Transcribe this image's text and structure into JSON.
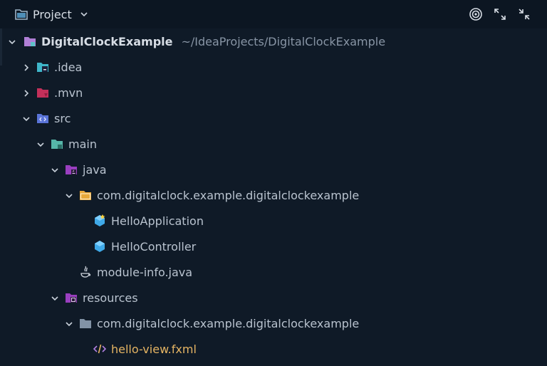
{
  "header": {
    "title": "Project",
    "icons": [
      "folder-icon",
      "chevron-down-icon",
      "target-icon",
      "expand-icon",
      "collapse-icon"
    ]
  },
  "tree": {
    "root": {
      "label": "DigitalClockExample",
      "path": "~/IdeaProjects/DigitalClockExample"
    },
    "items": [
      {
        "label": ".idea",
        "icon": "idea-folder-icon"
      },
      {
        "label": ".mvn",
        "icon": "mvn-folder-icon"
      },
      {
        "label": "src",
        "icon": "src-folder-icon"
      },
      {
        "label": "main",
        "icon": "main-folder-icon"
      },
      {
        "label": "java",
        "icon": "java-folder-icon"
      },
      {
        "label": "com.digitalclock.example.digitalclockexample",
        "icon": "package-icon"
      },
      {
        "label": "HelloApplication",
        "icon": "java-class-icon"
      },
      {
        "label": "HelloController",
        "icon": "java-class-icon"
      },
      {
        "label": "module-info.java",
        "icon": "java-file-icon"
      },
      {
        "label": "resources",
        "icon": "resources-folder-icon"
      },
      {
        "label": "com.digitalclock.example.digitalclockexample",
        "icon": "resource-package-icon"
      },
      {
        "label": "hello-view.fxml",
        "icon": "fxml-icon"
      }
    ]
  },
  "colors": {
    "background": "#0f1a27",
    "header": "#0c1622",
    "text": "#b9c3cf",
    "fxml": "#e5b463"
  }
}
